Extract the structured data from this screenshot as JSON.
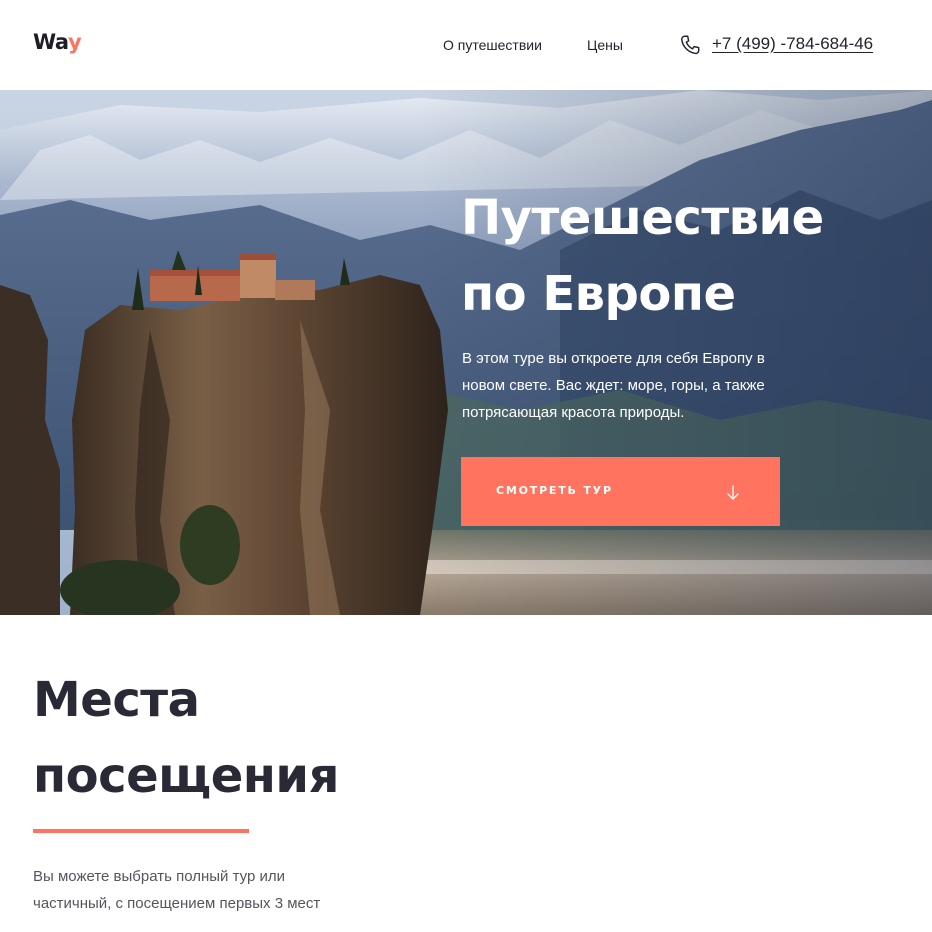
{
  "header": {
    "logo_main": "Wa",
    "logo_accent": "y",
    "nav": [
      {
        "label": "О путешествии"
      },
      {
        "label": "Цены"
      }
    ],
    "phone": "+7 (499) -784-684-46",
    "phone_icon": "phone-icon"
  },
  "hero": {
    "title_line1": "Путешествие",
    "title_line2": "по Европе",
    "description": "В этом туре вы откроете для себя Европу в новом свете. Вас ждет: море, горы, а также потрясающая красота природы.",
    "button_label": "СМОТРЕТЬ ТУР",
    "button_icon": "arrow-down-icon"
  },
  "places": {
    "title_line1": "Места",
    "title_line2": "посещения",
    "description": "Вы можете выбрать полный тур или частичный, с посещением первых 3 мест"
  },
  "colors": {
    "accent": "#ff735f",
    "text_dark": "#23232f",
    "text_muted": "#55555e"
  }
}
